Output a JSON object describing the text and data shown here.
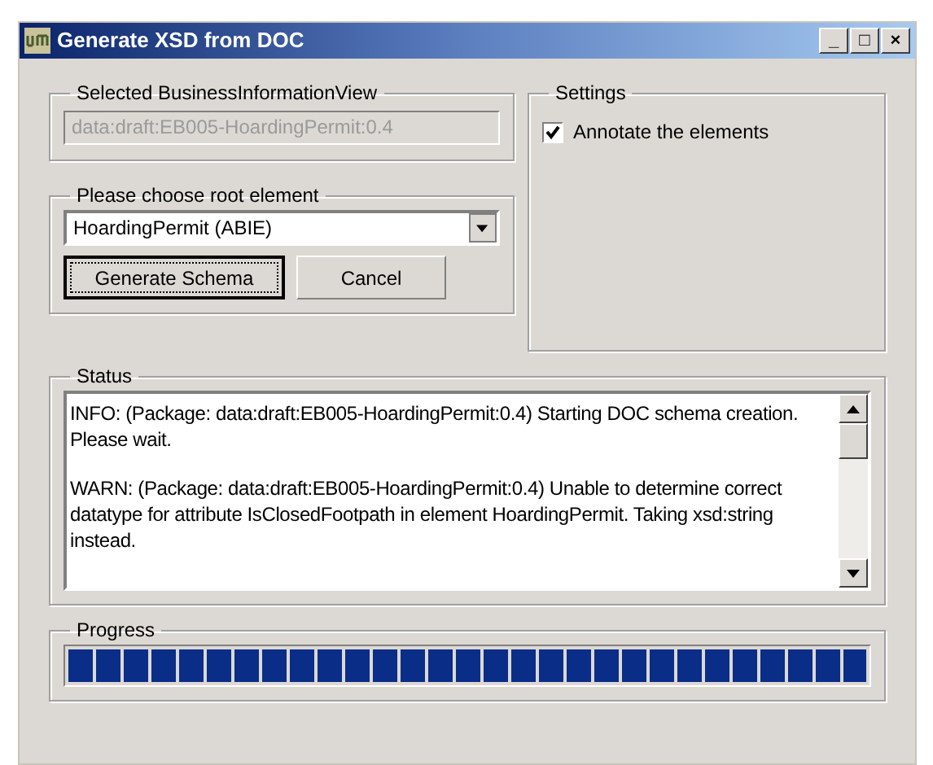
{
  "window": {
    "title": "Generate XSD from DOC",
    "controls": [
      "_",
      "□",
      "×"
    ]
  },
  "business_view": {
    "legend": "Selected BusinessInformationView",
    "value": "data:draft:EB005-HoardingPermit:0.4",
    "disabled": true
  },
  "settings": {
    "legend": "Settings",
    "options": [
      {
        "label": "Annotate the elements",
        "checked": true
      }
    ]
  },
  "root_element": {
    "legend": "Please choose root element",
    "value": "HoardingPermit (ABIE)"
  },
  "buttons": [
    {
      "label": "Generate Schema",
      "focused": true
    },
    {
      "label": "Cancel",
      "focused": false
    }
  ],
  "status": {
    "legend": "Status",
    "messages": [
      "INFO: (Package: data:draft:EB005-HoardingPermit:0.4) Starting DOC schema creation. Please wait.",
      "WARN: (Package: data:draft:EB005-HoardingPermit:0.4) Unable to determine correct datatype for attribute IsClosedFootpath in element HoardingPermit. Taking xsd:string instead."
    ]
  },
  "progress": {
    "legend": "Progress",
    "level": 1
  }
}
